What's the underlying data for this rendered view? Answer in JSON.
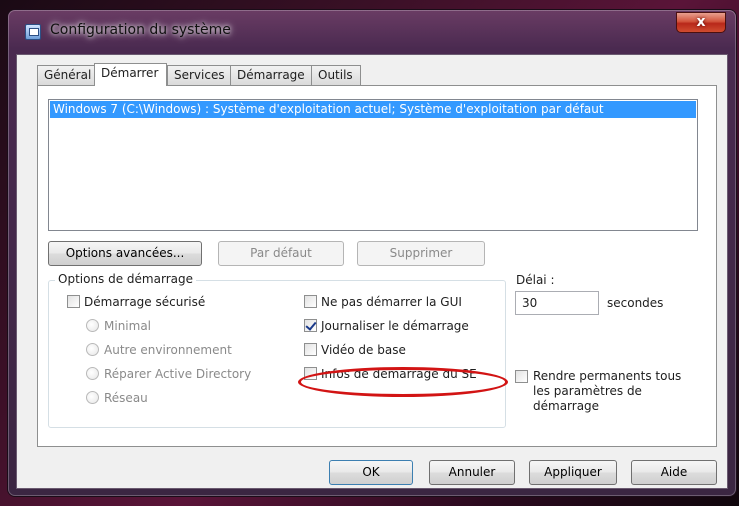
{
  "window": {
    "title": "Configuration du système",
    "close_label": "x"
  },
  "tabs": [
    {
      "label": "Général",
      "active": false
    },
    {
      "label": "Démarrer",
      "active": true
    },
    {
      "label": "Services",
      "active": false
    },
    {
      "label": "Démarrage",
      "active": false
    },
    {
      "label": "Outils",
      "active": false
    }
  ],
  "os_list": {
    "items": [
      "Windows 7 (C:\\Windows) : Système d'exploitation actuel; Système d'exploitation par défaut"
    ],
    "selected": 0
  },
  "list_buttons": {
    "advanced": "Options avancées...",
    "default": "Par défaut",
    "delete": "Supprimer"
  },
  "boot_options": {
    "group_label": "Options de démarrage",
    "safe_boot": {
      "label": "Démarrage sécurisé",
      "checked": false
    },
    "radios": [
      {
        "label": "Minimal",
        "enabled": false
      },
      {
        "label": "Autre environnement",
        "enabled": false
      },
      {
        "label": "Réparer Active Directory",
        "enabled": false
      },
      {
        "label": "Réseau",
        "enabled": false
      }
    ],
    "no_gui": {
      "label": "Ne pas démarrer la GUI",
      "checked": false
    },
    "boot_log": {
      "label": "Journaliser le démarrage",
      "checked": true
    },
    "base_video": {
      "label": "Vidéo de base",
      "checked": false
    },
    "os_boot_info": {
      "label": "Infos de démarrage du SE",
      "checked": false
    }
  },
  "timeout": {
    "label": "Délai :",
    "value": "30",
    "unit": "secondes"
  },
  "make_permanent": {
    "label": "Rendre permanents tous les paramètres de démarrage",
    "checked": false
  },
  "dialog_buttons": {
    "ok": "OK",
    "cancel": "Annuler",
    "apply": "Appliquer",
    "help": "Aide"
  },
  "highlight_color": "#d21414"
}
